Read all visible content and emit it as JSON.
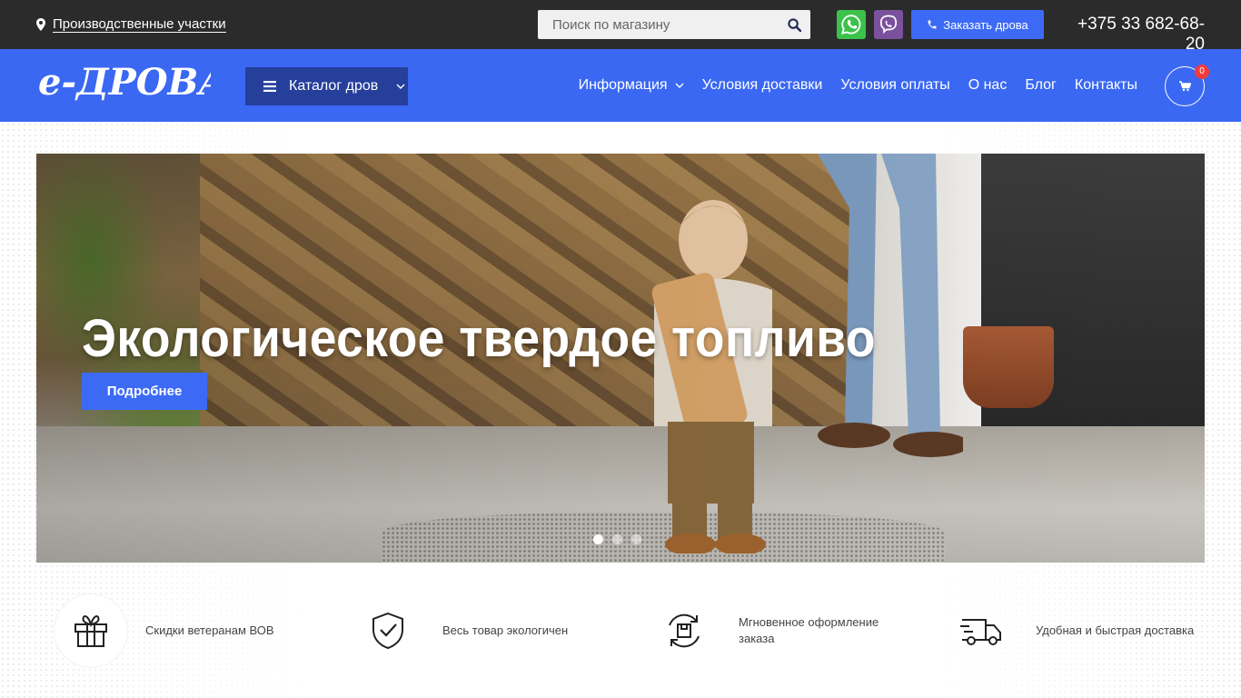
{
  "topbar": {
    "location_label": "Производственные участки",
    "search_placeholder": "Поиск по магазину",
    "order_button": "Заказать дрова",
    "phone": "+375 33 682-68-20"
  },
  "navbar": {
    "logo_text": "е-ДРОВА",
    "catalog_button": "Каталог дров",
    "menu": [
      {
        "label": "Информация"
      },
      {
        "label": "Условия доставки"
      },
      {
        "label": "Условия оплаты"
      },
      {
        "label": "О нас"
      },
      {
        "label": "Блог"
      },
      {
        "label": "Контакты"
      }
    ],
    "cart_count": "0"
  },
  "hero": {
    "title": "Экологическое твердое топливо",
    "button": "Подробнее",
    "slides": 3,
    "active_slide": 1
  },
  "features": [
    {
      "icon": "gift-icon",
      "label": "Скидки ветеранам ВОВ"
    },
    {
      "icon": "shield-check-icon",
      "label": "Весь товар экологичен"
    },
    {
      "icon": "refresh-box-icon",
      "label": "Мгновенное оформление заказа"
    },
    {
      "icon": "delivery-truck-icon",
      "label": "Удобная и быстрая доставка"
    }
  ],
  "colors": {
    "topbar_bg": "#2b2b2b",
    "navbar_bg": "#3a68f3",
    "accent": "#3d6af5",
    "catalog_bg": "#253f9b",
    "whatsapp": "#3cc24a",
    "viber": "#7b519d",
    "badge": "#f23b3b"
  }
}
